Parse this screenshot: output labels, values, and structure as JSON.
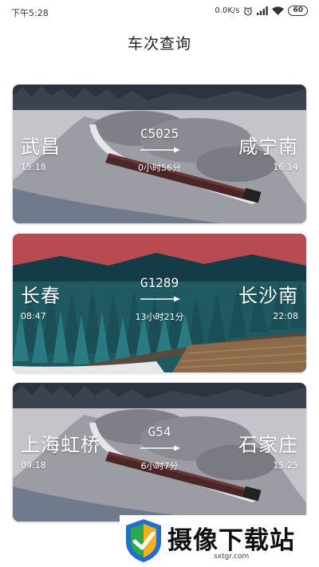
{
  "status_bar": {
    "time": "下午5:28",
    "net_speed": "0.0K/s",
    "battery": "60"
  },
  "page": {
    "title": "车次查询"
  },
  "trips": [
    {
      "from": "武昌",
      "to": "咸宁南",
      "train_no": "C5025",
      "departure": "15:18",
      "arrival": "16:14",
      "duration": "0小时56分"
    },
    {
      "from": "长春",
      "to": "长沙南",
      "train_no": "G1289",
      "departure": "08:47",
      "arrival": "22:08",
      "duration": "13小时21分"
    },
    {
      "from": "上海虹桥",
      "to": "石家庄",
      "train_no": "G54",
      "departure": "09:18",
      "arrival": "15:25",
      "duration": "6小时7分"
    }
  ],
  "watermark": {
    "name": "摄像下载站",
    "url": "sxtgr.com"
  },
  "icons": [
    "alarm-icon",
    "cellular-signal-icon",
    "wifi-icon",
    "battery-icon",
    "arrow-right-icon",
    "site-logo-icon"
  ]
}
